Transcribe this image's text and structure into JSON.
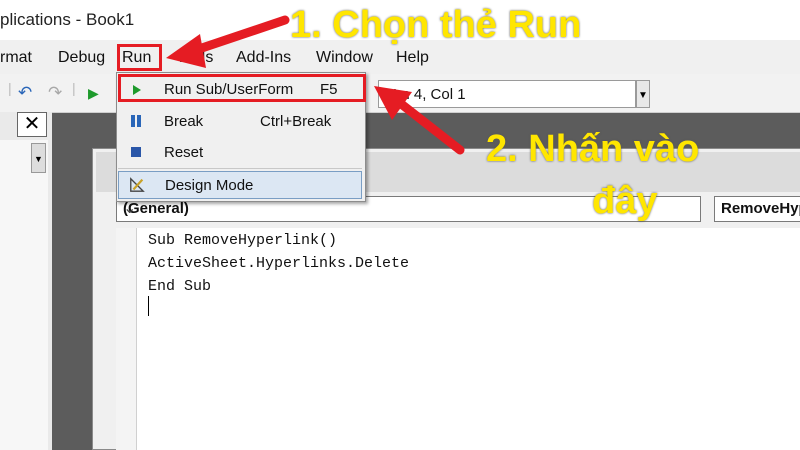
{
  "window": {
    "title": "plications - Book1"
  },
  "menubar": {
    "items": [
      "rmat",
      "Debug",
      "Run",
      "Tools",
      "Add-Ins",
      "Window",
      "Help"
    ]
  },
  "toolbar": {
    "status": "Ln 4, Col 1"
  },
  "left_panel": {
    "close_label": "✕"
  },
  "code_window": {
    "object_combo": "(General)",
    "procedure_combo": "RemoveHyperlink",
    "lines": [
      "Sub RemoveHyperlink()",
      "ActiveSheet.Hyperlinks.Delete",
      "End Sub"
    ]
  },
  "run_menu": {
    "items": [
      {
        "label": "Run Sub/UserForm",
        "shortcut": "F5",
        "icon": "play-icon"
      },
      {
        "label": "Break",
        "shortcut": "Ctrl+Break",
        "icon": "pause-icon"
      },
      {
        "label": "Reset",
        "shortcut": "",
        "icon": "stop-icon"
      },
      {
        "label": "Design Mode",
        "shortcut": "",
        "icon": "design-mode-icon"
      }
    ]
  },
  "annotations": {
    "step1": "1. Chọn thẻ Run",
    "step2_line1": "2. Nhấn vào",
    "step2_line2": "đây"
  },
  "colors": {
    "highlight": "#e51c23",
    "annotation_text": "#ffe600",
    "menu_hover": "#dce7f3"
  }
}
